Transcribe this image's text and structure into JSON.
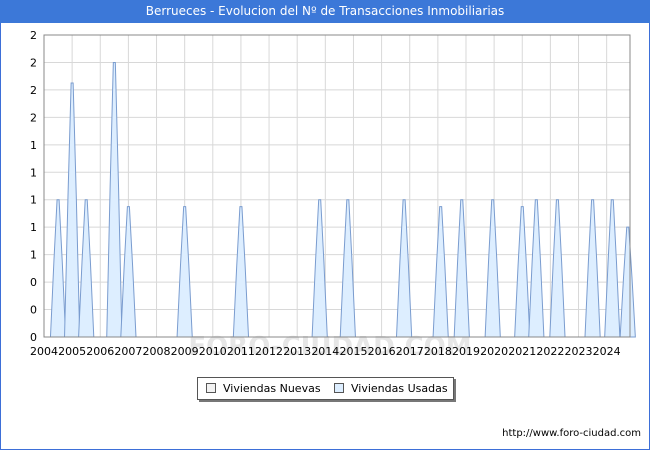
{
  "window": {
    "title": "Berrueces - Evolucion del Nº de Transacciones Inmobiliarias",
    "footer_url": "http://www.foro-ciudad.com",
    "watermark": "FORO-CIUDAD.COM"
  },
  "colors": {
    "title_bg": "#3c78d8",
    "title_text": "#ffffff",
    "new_fill": "#f2f2f2",
    "used_fill": "#ddeeff",
    "used_stroke": "#7a9ccf",
    "grid": "#d8d8d8"
  },
  "chart_data": {
    "type": "area",
    "title": "Berrueces - Evolucion del Nº de Transacciones Inmobiliarias",
    "xlabel": "",
    "ylabel": "",
    "grid": true,
    "legend_position": "bottom",
    "x_range": [
      2004,
      2024.83
    ],
    "x_ticks": [
      "2004",
      "2005",
      "2006",
      "2007",
      "2008",
      "2009",
      "2010",
      "2011",
      "2012",
      "2013",
      "2014",
      "2015",
      "2016",
      "2017",
      "2018",
      "2019",
      "2020",
      "2021",
      "2022",
      "2023",
      "2024"
    ],
    "ylim": [
      0,
      2.2
    ],
    "y_tick_values": [
      0,
      0.2,
      0.4,
      0.6,
      0.8,
      1.0,
      1.2,
      1.4,
      1.6,
      1.8,
      2.0,
      2.2
    ],
    "y_tick_labels": [
      "0",
      "0",
      "0",
      "1",
      "1",
      "1",
      "1",
      "1",
      "2",
      "2",
      "2",
      "2"
    ],
    "series": [
      {
        "name": "Viviendas Nuevas",
        "peaks": []
      },
      {
        "name": "Viviendas Usadas",
        "peaks": [
          {
            "x": 2004.5,
            "y": 1.0
          },
          {
            "x": 2005.0,
            "y": 1.85
          },
          {
            "x": 2005.5,
            "y": 1.0
          },
          {
            "x": 2006.5,
            "y": 2.0
          },
          {
            "x": 2007.0,
            "y": 0.95
          },
          {
            "x": 2009.0,
            "y": 0.95
          },
          {
            "x": 2011.0,
            "y": 0.95
          },
          {
            "x": 2013.8,
            "y": 1.0
          },
          {
            "x": 2014.8,
            "y": 1.0
          },
          {
            "x": 2016.8,
            "y": 1.0
          },
          {
            "x": 2018.1,
            "y": 0.95
          },
          {
            "x": 2018.85,
            "y": 1.0
          },
          {
            "x": 2019.95,
            "y": 1.0
          },
          {
            "x": 2021.0,
            "y": 0.95
          },
          {
            "x": 2021.5,
            "y": 1.0
          },
          {
            "x": 2022.25,
            "y": 1.0
          },
          {
            "x": 2023.5,
            "y": 1.0
          },
          {
            "x": 2024.2,
            "y": 1.0
          },
          {
            "x": 2024.75,
            "y": 0.8
          }
        ]
      }
    ]
  }
}
